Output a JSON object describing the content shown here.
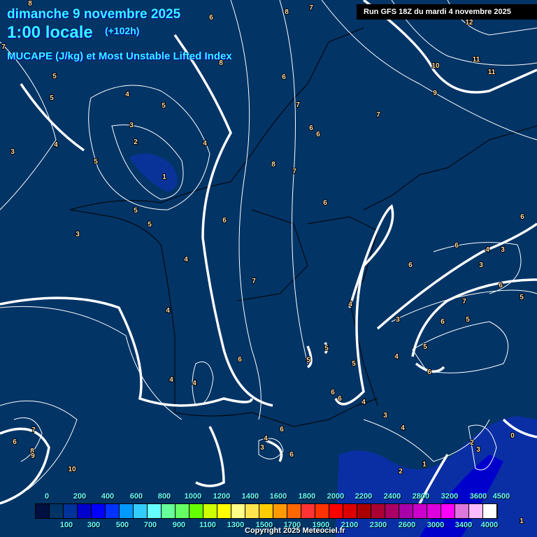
{
  "header": {
    "date": "dimanche 9 novembre 2025",
    "hour": "1:00 locale",
    "lead": "(+102h)",
    "parameter": "MUCAPE (J/kg) et Most Unstable Lifted Index",
    "run": "Run GFS 18Z du mardi 4 novembre 2025"
  },
  "legend": {
    "colors": [
      "#001040",
      "#003366",
      "#003399",
      "#0000cc",
      "#0000ff",
      "#0033ff",
      "#0099ff",
      "#33ccff",
      "#66ffff",
      "#66ff99",
      "#66ff66",
      "#66ff00",
      "#ccff00",
      "#ffff00",
      "#ffff88",
      "#ffe44f",
      "#ffcc00",
      "#ff9900",
      "#ff6600",
      "#ff3333",
      "#ff3300",
      "#ff0000",
      "#dd0000",
      "#aa0000",
      "#aa0033",
      "#aa0066",
      "#aa00aa",
      "#cc00cc",
      "#dd00dd",
      "#ff00ff",
      "#dd77dd",
      "#ffbbff",
      "#ffffff"
    ],
    "top_labels": [
      "0",
      "200",
      "400",
      "600",
      "800",
      "1000",
      "1200",
      "1400",
      "1600",
      "1800",
      "2000",
      "2200",
      "2400",
      "2800",
      "3200",
      "3600",
      "4500"
    ],
    "bottom_labels": [
      "100",
      "300",
      "500",
      "700",
      "900",
      "1100",
      "1300",
      "1500",
      "1700",
      "1900",
      "2100",
      "2300",
      "2600",
      "3000",
      "3400",
      "4000"
    ]
  },
  "contour_labels": [
    "8",
    "7",
    "6",
    "8",
    "7",
    "12",
    "10",
    "11",
    "11",
    "8",
    "9",
    "7",
    "5",
    "6",
    "5",
    "4",
    "5",
    "7",
    "4",
    "5",
    "3",
    "2",
    "4",
    "1",
    "3",
    "5",
    "5",
    "6",
    "4",
    "6",
    "6",
    "8",
    "7",
    "6",
    "6",
    "3",
    "7",
    "4",
    "4",
    "4",
    "6",
    "5",
    "5",
    "5",
    "6",
    "6",
    "4",
    "3",
    "4",
    "3",
    "5",
    "6",
    "6",
    "6",
    "4",
    "3",
    "3",
    "6",
    "4",
    "7",
    "5",
    "6",
    "5",
    "4",
    "6",
    "7",
    "6",
    "8",
    "9",
    "10",
    "4",
    "3",
    "6",
    "1",
    "2",
    "2",
    "3",
    "0",
    "1"
  ],
  "copyright": "Copyright 2025 Meteociel.fr"
}
